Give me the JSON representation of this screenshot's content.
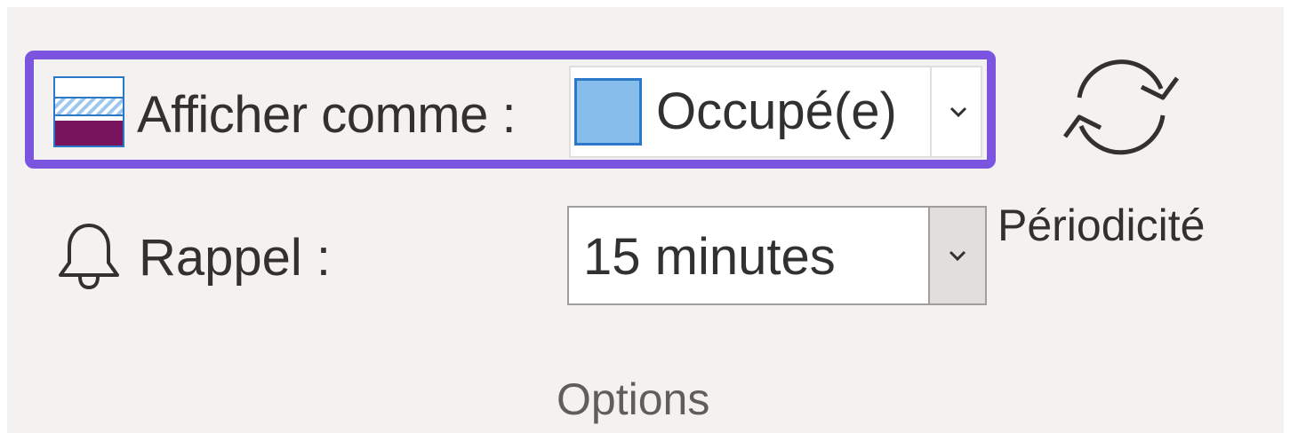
{
  "group": {
    "label": "Options"
  },
  "show_as": {
    "label": "Afficher comme :",
    "value": "Occupé(e)",
    "swatch_color": "#87bdeb",
    "highlight_color": "#7b55e0",
    "icon": "show-as-icon"
  },
  "reminder": {
    "label": "Rappel :",
    "value": "15 minutes",
    "icon": "bell-icon"
  },
  "recurrence": {
    "label": "Périodicité",
    "icon": "recurrence-icon"
  }
}
